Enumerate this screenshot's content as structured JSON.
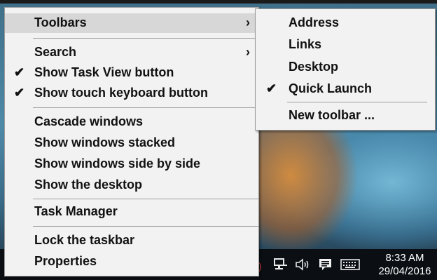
{
  "menu": {
    "toolbars_label": "Toolbars",
    "search_label": "Search",
    "task_view_label": "Show Task View button",
    "touch_keyboard_label": "Show touch keyboard button",
    "cascade_label": "Cascade windows",
    "stacked_label": "Show windows stacked",
    "side_by_side_label": "Show windows side by side",
    "desktop_label": "Show the desktop",
    "task_manager_label": "Task Manager",
    "lock_label": "Lock the taskbar",
    "properties_label": "Properties",
    "checkmark": "✔",
    "submenu_arrow": "›"
  },
  "submenu": {
    "address_label": "Address",
    "links_label": "Links",
    "desktop_label": "Desktop",
    "quick_launch_label": "Quick Launch",
    "new_toolbar_label": "New toolbar ...",
    "checkmark": "✔"
  },
  "taskbar": {
    "time": "8:33 AM",
    "date": "29/04/2016",
    "icons": [
      "network-icon",
      "volume-icon",
      "action-center-icon",
      "touch-keyboard-icon"
    ]
  },
  "colors": {
    "menu_background": "#f2f2f2",
    "highlight": "#d7d7d7",
    "taskbar": "#0b0f14"
  }
}
